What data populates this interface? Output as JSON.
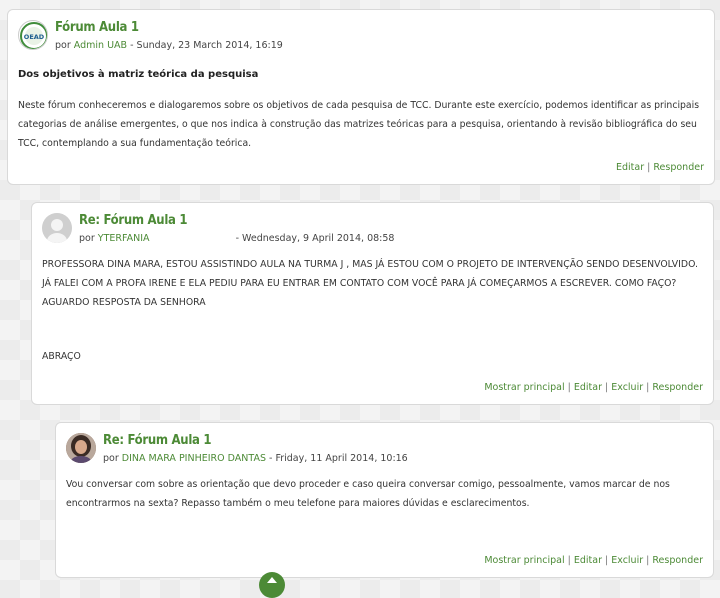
{
  "posts": [
    {
      "subject": "Fórum Aula 1",
      "by": "por",
      "author": "Admin UAB",
      "date": "- Sunday, 23 March 2014, 16:19",
      "title": "Dos objetivos à matriz teórica da pesquisa",
      "body": "Neste fórum conheceremos e dialogaremos sobre os objetivos de cada pesquisa de TCC. Durante este exercício, podemos identificar as principais categorias de análise emergentes, o que nos indica à construção das matrizes teóricas para a pesquisa, orientando à revisão bibliográfica do seu TCC, contemplando a sua fundamentação teórica.",
      "avatar_text": "OEAD",
      "commands": [
        "Editar",
        "Responder"
      ]
    },
    {
      "subject": "Re: Fórum Aula 1",
      "by": "por",
      "author": "YTERFANIA",
      "date": "- Wednesday, 9 April 2014, 08:58",
      "body": "PROFESSORA DINA MARA, ESTOU ASSISTINDO AULA NA TURMA J , MAS JÁ ESTOU COM O PROJETO DE INTERVENÇÃO SENDO DESENVOLVIDO. JÁ FALEI COM A PROFA IRENE E ELA PEDIU PARA EU ENTRAR EM CONTATO COM VOCÊ PARA JÁ COMEÇARMOS A ESCREVER. COMO FAÇO? AGUARDO RESPOSTA DA SENHORA",
      "closing": "ABRAÇO",
      "commands": [
        "Mostrar principal",
        "Editar",
        "Excluir",
        "Responder"
      ]
    },
    {
      "subject": "Re: Fórum Aula 1",
      "by": "por",
      "author": "DINA MARA PINHEIRO DANTAS",
      "date": "- Friday, 11 April 2014, 10:16",
      "body": "Vou conversar com sobre as orientação que devo proceder e caso queira conversar comigo, pessoalmente, vamos marcar de nos encontrarmos na sexta? Repasso também o meu telefone para maiores dúvidas e esclarecimentos.",
      "commands": [
        "Mostrar principal",
        "Editar",
        "Excluir",
        "Responder"
      ]
    }
  ],
  "colors": {
    "accent": "#4c8a36",
    "border": "#d9d9d9"
  }
}
